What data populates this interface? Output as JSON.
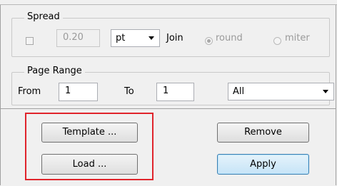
{
  "spread": {
    "legend": "Spread",
    "value": "0.20",
    "unit": "pt",
    "join_label": "Join",
    "options": [
      "round",
      "miter"
    ],
    "selected": "round"
  },
  "page_range": {
    "legend": "Page Range",
    "from_label": "From",
    "from_value": "1",
    "to_label": "To",
    "to_value": "1",
    "scope": "All"
  },
  "buttons": {
    "template": "Template ...",
    "load": "Load ...",
    "remove": "Remove",
    "apply": "Apply"
  },
  "colors": {
    "highlight": "#e0242c",
    "default_button_border": "#3c7fb1"
  }
}
